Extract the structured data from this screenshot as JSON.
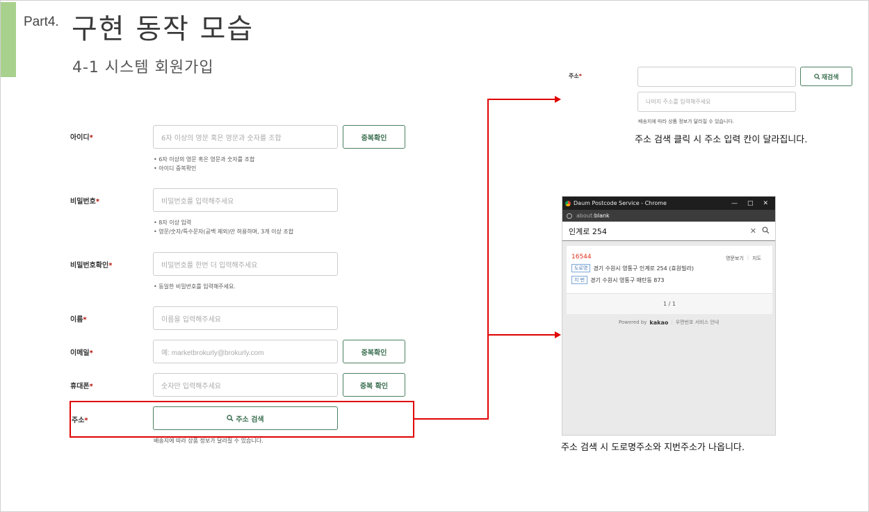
{
  "header": {
    "part": "Part4.",
    "title": "구현 동작 모습",
    "subtitle": "4-1 시스템 회원가입"
  },
  "form": {
    "id": {
      "label": "아이디",
      "placeholder": "6자 이상의 영문 혹은 영문과 숫자를 조합",
      "button": "중복확인",
      "hints": [
        "• 6자 이상의 영문 혹은 영문과 숫자를 조합",
        "• 아이디 중복확인"
      ]
    },
    "password": {
      "label": "비밀번호",
      "placeholder": "비밀번호를 입력해주세요",
      "hints": [
        "• 8자 이상 입력",
        "• 영문/숫자/특수문자(공백 제외)만 허용하며, 3개 이상 조합"
      ]
    },
    "password_confirm": {
      "label": "비밀번호확인",
      "placeholder": "비밀번호를 한번 더 입력해주세요",
      "hints": [
        "• 동일한 비밀번호를 입력해주세요."
      ]
    },
    "name": {
      "label": "이름",
      "placeholder": "이름을 입력해주세요"
    },
    "email": {
      "label": "이메일",
      "placeholder": "예: marketbrokurly@brokurly.com",
      "button": "중복확인"
    },
    "phone": {
      "label": "휴대폰",
      "placeholder": "숫자만 입력해주세요",
      "button": "중복 확인"
    },
    "address": {
      "label": "주소",
      "button": "주소 검색",
      "note": "배송지에 따라 상품 정보가 달라질 수 있습니다."
    },
    "required_mark": "*"
  },
  "address_expanded": {
    "label": "주소",
    "research_button": "재검색",
    "detail_placeholder": "나머지 주소를 입력해주세요",
    "note": "배송지에 따라 상품 정보가 달라질 수 있습니다.",
    "caption": "주소 검색 클릭 시 주소 입력 칸이 달라집니다."
  },
  "popup": {
    "window_title": "Daum Postcode Service - Chrome",
    "url_prefix": "about:",
    "url_rest": "blank",
    "query": "인계로 254",
    "result": {
      "zipcode": "16544",
      "road_tag": "도로명",
      "road_address": "경기 수원시 영통구 인계로 254 (효원빌라)",
      "lot_tag": "지 번",
      "lot_address": "경기 수원시 영통구 매탄동 873",
      "english_link": "영문보기",
      "map_link": "지도"
    },
    "pager": "1 / 1",
    "powered_by": "Powered by",
    "brand": "kakao",
    "service_info": "우편번호 서비스 안내",
    "caption": "주소 검색 시 도로명주소와 지번주소가 나옵니다."
  },
  "colors": {
    "accent_green": "#3b6f50",
    "required_red": "#b3130b",
    "highlight_red": "#e00000",
    "zip_red": "#e0301e",
    "bar_green": "#a9d18e"
  }
}
